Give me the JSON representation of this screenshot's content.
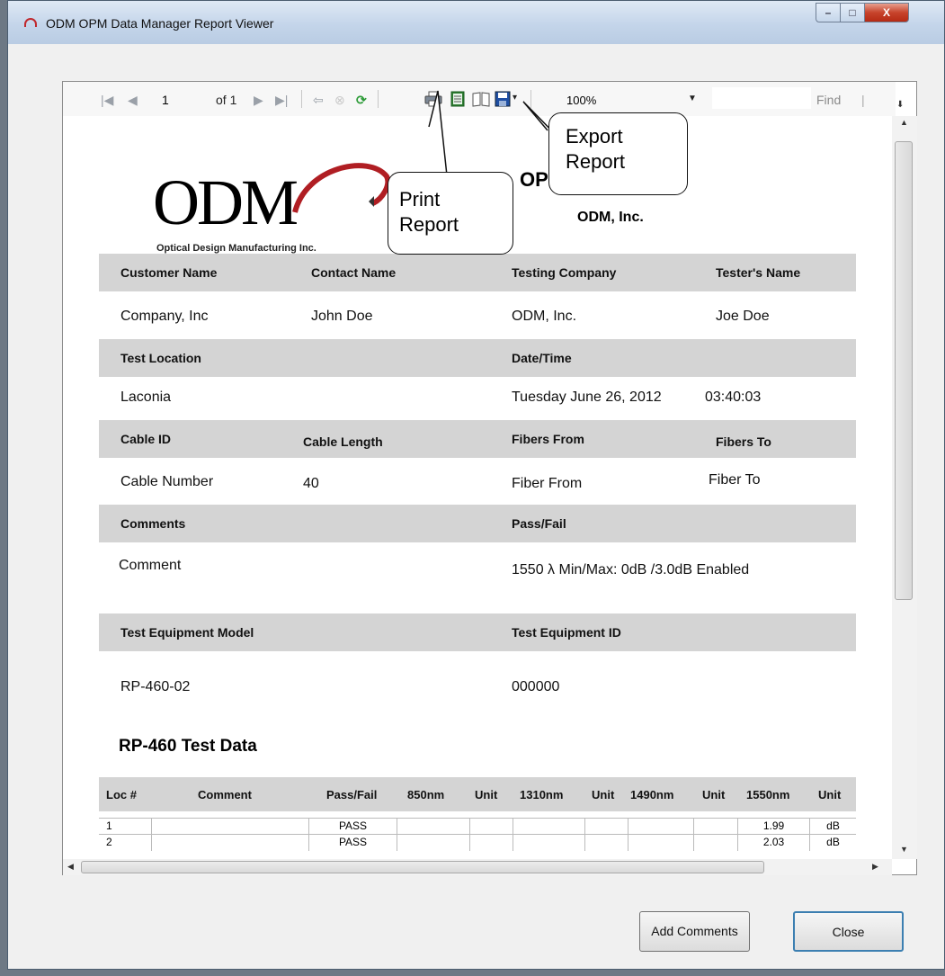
{
  "window": {
    "title": "ODM OPM Data Manager Report Viewer",
    "min_label": "–",
    "max_label": "□",
    "close_label": "X"
  },
  "toolbar": {
    "first_icon": "|◀",
    "prev_icon": "◀",
    "page": "1",
    "of_label": "of 1",
    "next_icon": "▶",
    "last_icon": "▶|",
    "back_icon": "⇦",
    "stop_icon": "⊗",
    "refresh_icon": "⟳",
    "zoom": "100%",
    "find_label": "Find",
    "find_sep": "|"
  },
  "report": {
    "logo_text": "ODM",
    "logo_subtitle": "Optical Design Manufacturing Inc.",
    "title": "OPM Test Report",
    "company": "ODM, Inc.",
    "customer_name_label": "Customer Name",
    "contact_name_label": "Contact Name",
    "testing_company_label": "Testing Company",
    "testers_name_label": "Tester's Name",
    "customer_name": "Company, Inc",
    "contact_name": "John Doe",
    "testing_company": "ODM, Inc.",
    "testers_name": "Joe Doe",
    "test_location_label": "Test Location",
    "date_time_label": "Date/Time",
    "test_location": "Laconia",
    "date": "Tuesday June 26, 2012",
    "time": "03:40:03",
    "cable_id_label": "Cable ID",
    "cable_length_label": "Cable Length",
    "fibers_from_label": "Fibers From",
    "fibers_to_label": "Fibers To",
    "cable_id": "Cable Number",
    "cable_length": "40",
    "fibers_from": "Fiber From",
    "fibers_to": "Fiber To",
    "comments_label": "Comments",
    "pass_fail_label": "Pass/Fail",
    "comments": "Comment",
    "pass_fail": "1550 λ Min/Max: 0dB /3.0dB  Enabled",
    "equipment_model_label": "Test Equipment Model",
    "equipment_id_label": "Test Equipment ID",
    "equipment_model": "RP-460-02",
    "equipment_id": "000000",
    "section_title": "RP-460 Test Data"
  },
  "table": {
    "headers": [
      "Loc #",
      "Comment",
      "Pass/Fail",
      "850nm",
      "Unit",
      "1310nm",
      "Unit",
      "1490nm",
      "Unit",
      "1550nm",
      "Unit"
    ],
    "rows": [
      [
        "1",
        "",
        "PASS",
        "",
        "",
        "",
        "",
        "",
        "",
        "1.99",
        "dB"
      ],
      [
        "2",
        "",
        "PASS",
        "",
        "",
        "",
        "",
        "",
        "",
        "2.03",
        "dB"
      ]
    ]
  },
  "callouts": {
    "print": "Print Report",
    "export": "Export Report"
  },
  "buttons": {
    "add_comments": "Add Comments",
    "close": "Close"
  }
}
